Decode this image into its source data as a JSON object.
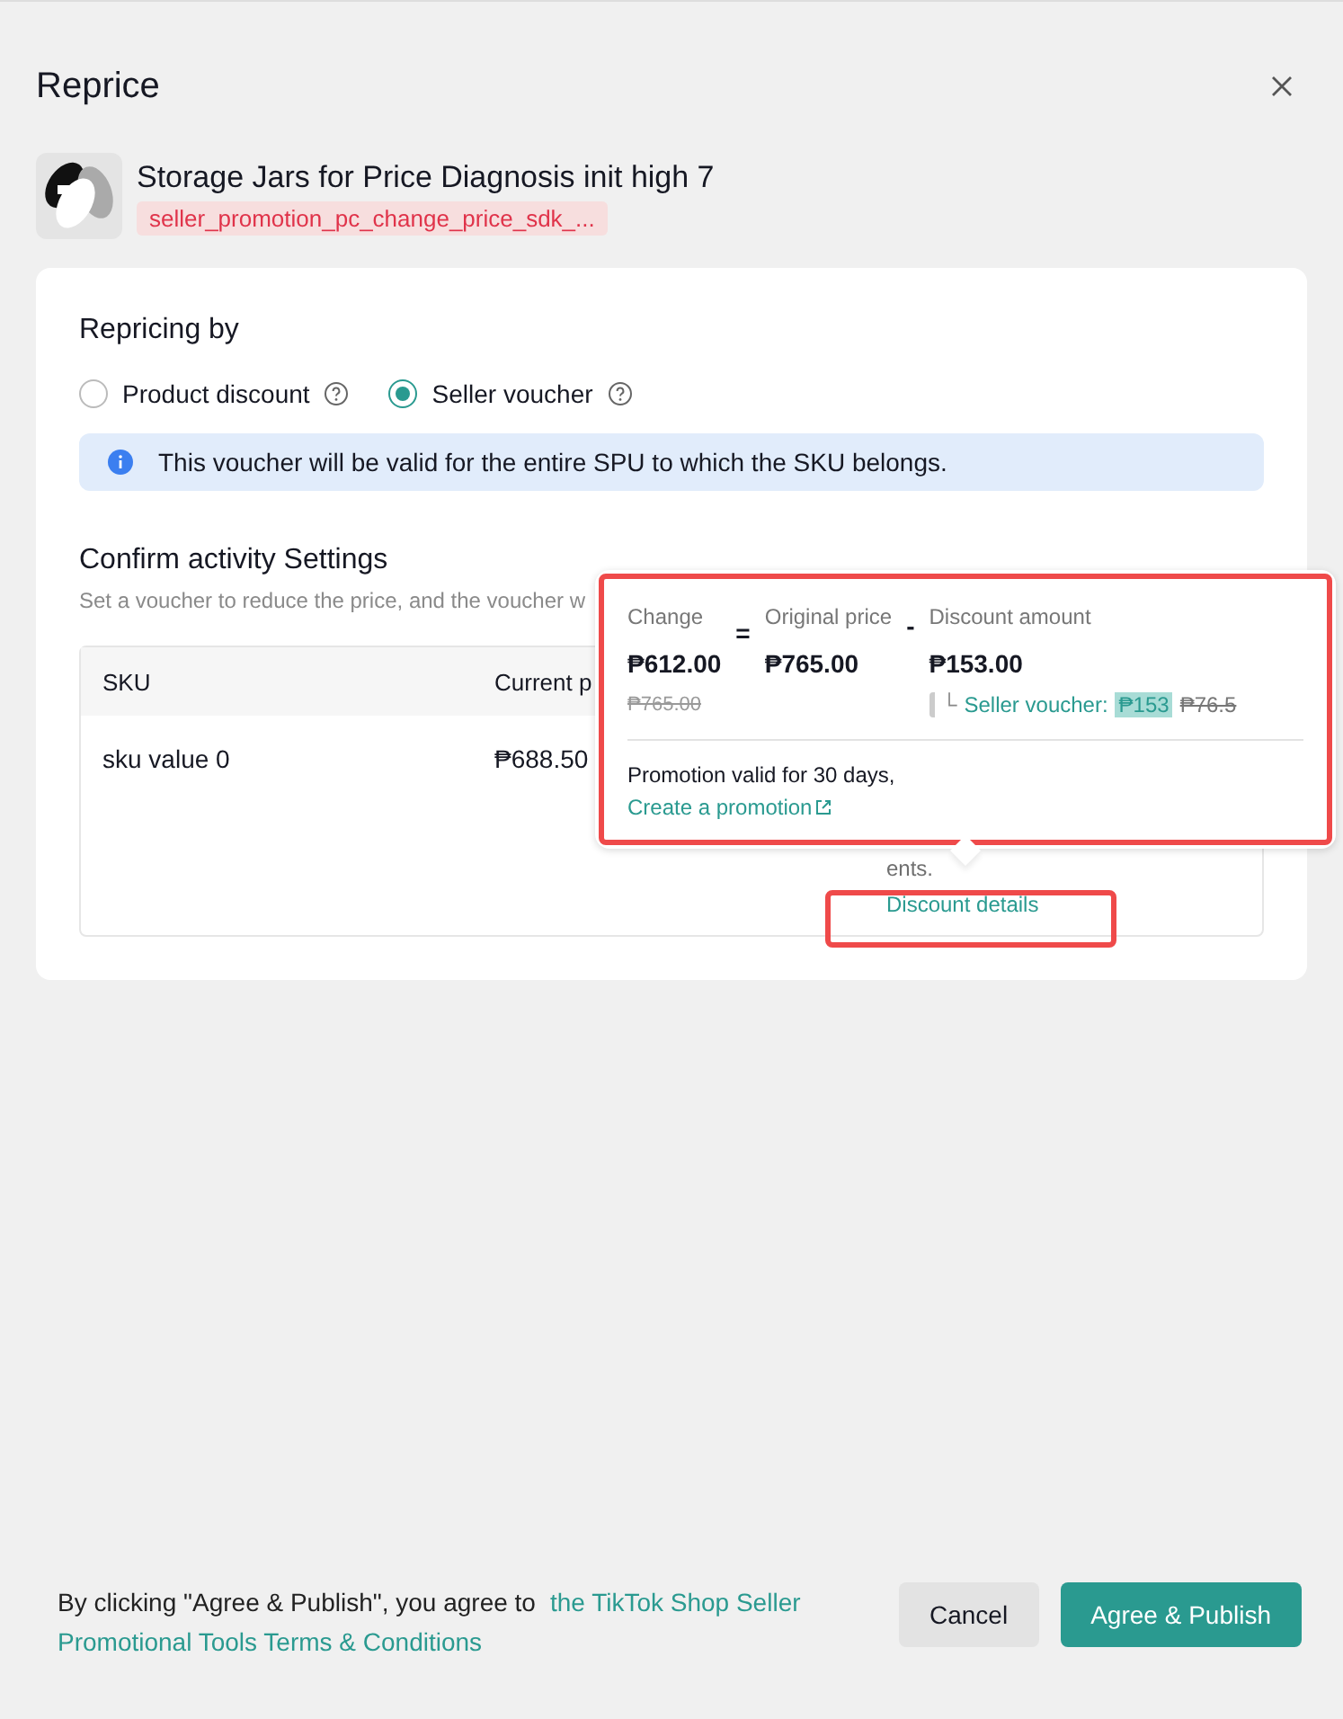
{
  "dialog": {
    "title": "Reprice"
  },
  "product": {
    "name": "Storage Jars for Price Diagnosis init high 7",
    "tag": "seller_promotion_pc_change_price_sdk_..."
  },
  "repricing": {
    "title": "Repricing by",
    "options": [
      {
        "label": "Product discount",
        "selected": false
      },
      {
        "label": "Seller voucher",
        "selected": true
      }
    ],
    "info": "This voucher will be valid for the entire SPU to which the SKU belongs."
  },
  "activity": {
    "title": "Confirm activity Settings",
    "subtitle": "Set a voucher to reduce the price, and the voucher w",
    "columns": [
      "SKU",
      "Current p"
    ],
    "rows": [
      {
        "sku": "sku value 0",
        "current_price": "₱688.50",
        "column_3": "ents.",
        "link": "Discount details"
      }
    ]
  },
  "popover": {
    "change_label": "Change",
    "change_value": "₱612.00",
    "change_was": "₱765.00",
    "equals": "=",
    "original_label": "Original price",
    "original_value": "₱765.00",
    "minus": "-",
    "discount_label": "Discount amount",
    "discount_value": "₱153.00",
    "branch": "└",
    "voucher_label": "Seller voucher:",
    "voucher_value": "₱153",
    "voucher_was": "₱76.5",
    "note": "Promotion valid for 30 days,",
    "link": "Create a promotion"
  },
  "footer": {
    "text": "By clicking \"Agree & Publish\", you agree to",
    "link_lines": [
      "the TikTok Shop Seller",
      "Promotional Tools Terms & Conditions"
    ],
    "buttons": [
      {
        "label": "Cancel",
        "kind": "secondary"
      },
      {
        "label": "Agree & Publish",
        "kind": "primary"
      }
    ]
  }
}
